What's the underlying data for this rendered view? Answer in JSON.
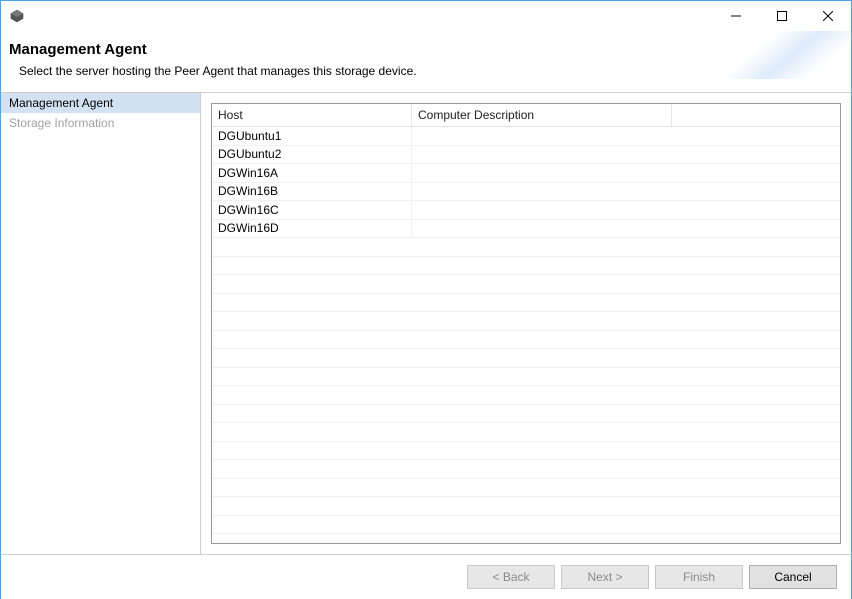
{
  "header": {
    "title": "Management Agent",
    "subtitle": "Select the server hosting the Peer Agent that manages this storage device."
  },
  "nav": {
    "items": [
      {
        "label": "Management Agent",
        "selected": true,
        "disabled": false
      },
      {
        "label": "Storage Information",
        "selected": false,
        "disabled": true
      }
    ]
  },
  "table": {
    "columns": {
      "host": "Host",
      "desc": "Computer Description"
    },
    "rows": [
      {
        "host": "DGUbuntu1",
        "desc": ""
      },
      {
        "host": "DGUbuntu2",
        "desc": ""
      },
      {
        "host": "DGWin16A",
        "desc": ""
      },
      {
        "host": "DGWin16B",
        "desc": ""
      },
      {
        "host": "DGWin16C",
        "desc": ""
      },
      {
        "host": "DGWin16D",
        "desc": ""
      }
    ],
    "empty_rows": 17
  },
  "footer": {
    "back": "< Back",
    "next": "Next >",
    "finish": "Finish",
    "cancel": "Cancel"
  }
}
